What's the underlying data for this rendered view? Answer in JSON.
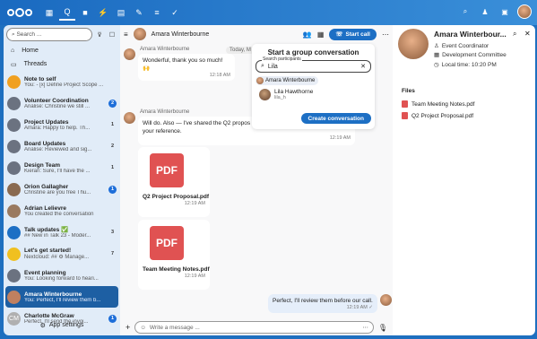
{
  "topbar": {
    "apps": [
      "dashboard-icon",
      "talk-icon",
      "files-icon",
      "activity-icon",
      "calendar-icon",
      "notes-icon",
      "tasks-icon",
      "checkmark-icon"
    ]
  },
  "sidebar": {
    "search_placeholder": "Search ...",
    "nav": [
      {
        "label": "Home"
      },
      {
        "label": "Threads"
      }
    ],
    "conversations": [
      {
        "title": "Note to self",
        "sub": "You: - [x] Define Project Scope ...",
        "badge": "",
        "av": "#f0a020"
      },
      {
        "title": "Volunteer Coordination",
        "sub": "Analise: Christine we still ...",
        "badge": "2",
        "av": "#6b7280"
      },
      {
        "title": "Project Updates",
        "sub": "Amara: Happy to help. Th...",
        "badge": "1",
        "av": "#6b7280"
      },
      {
        "title": "Board Updates",
        "sub": "Analise: Reviewed and sig...",
        "badge": "2",
        "av": "#6b7280"
      },
      {
        "title": "Design Team",
        "sub": "Kieran: Sure, I'll have the ...",
        "badge": "1",
        "av": "#6b7280"
      },
      {
        "title": "Orion Gallagher",
        "sub": "Christine are you free Thu...",
        "badge": "1",
        "av": "#8a6a50"
      },
      {
        "title": "Adrian Lelievre",
        "sub": "You created the conversation",
        "badge": "",
        "av": "#9a7a60"
      },
      {
        "title": "Talk updates ✅",
        "sub": "## New in Talk 23 - Moder...",
        "badge": "3",
        "av": "#1d6fc4"
      },
      {
        "title": "Let's get started!",
        "sub": "Nextcloud: ## ⚙ Manage...",
        "badge": "7",
        "av": "#f0c020"
      },
      {
        "title": "Event planning",
        "sub": "You: Looking forward to heari...",
        "badge": "",
        "av": "#6b7280"
      },
      {
        "title": "Amara Winterbourne",
        "sub": "You: Perfect, I'll review them b...",
        "badge": "",
        "av": "#c08060",
        "active": true
      },
      {
        "title": "Charlotte McGraw",
        "sub": "Perfect. I'll send the invoi...",
        "badge": "1",
        "av": "#b0b0b0",
        "initials": "CM"
      }
    ],
    "settings_label": "App settings"
  },
  "chat": {
    "name": "Amara Winterbourne",
    "start_call": "Start call",
    "date_chip": "Today, M",
    "msg1_name": "Amara Winterbourne",
    "msg1_text": "Wonderful, thank you so much! 🙌",
    "msg1_time": "12:18 AM",
    "msg2_name": "Amara Winterbourne",
    "msg2_text": "Will do. Also — I've shared the Q2 propos",
    "msg2_text2": "your reference.",
    "msg2_time": "12:19 AM",
    "file1_name": "Q2 Project Proposal.pdf",
    "file1_time": "12:19 AM",
    "file2_name": "Team Meeting Notes.pdf",
    "file2_time": "12:19 AM",
    "reply_text": "Perfect, I'll review them before our call.",
    "reply_time": "12:19 AM ✓",
    "input_placeholder": "Write a message ...",
    "pdf_label": "PDF"
  },
  "popup": {
    "title": "Start a group conversation",
    "field_label": "Search participants",
    "field_value": "Lila",
    "chip": "Amara Winterbourne",
    "result_name": "Lila Hawthorne",
    "result_sub": "lila_h",
    "create": "Create conversation"
  },
  "right": {
    "name": "Amara Winterbour...",
    "role": "Event Coordinator",
    "org": "Development Committee",
    "time": "Local time: 10:20 PM",
    "files_heading": "Files",
    "files": [
      "Team Meeting Notes.pdf",
      "Q2 Project Proposal.pdf"
    ]
  }
}
